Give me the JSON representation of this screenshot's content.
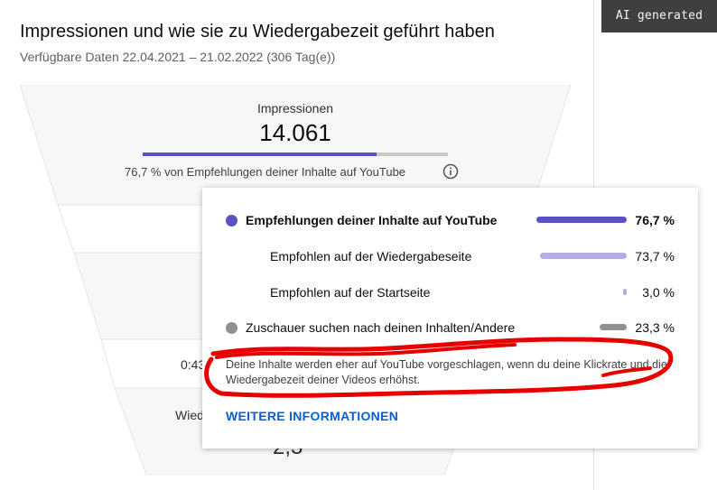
{
  "badge": "AI generated",
  "header": {
    "title": "Impressionen und wie sie zu Wiedergabezeit geführt haben",
    "subtitle": "Verfügbare Daten 22.04.2021 – 21.02.2022 (306 Tag(e))"
  },
  "funnel": {
    "impressions_label": "Impressionen",
    "impressions_value": "14.061",
    "recommendation_share": 0.767,
    "impressions_desc": "76,7 % von Empfehlungen deiner Inhalte auf YouTube",
    "stage_partial_1": "0:43",
    "stage_partial_2": "Wied",
    "stage_partial_3": "2,3"
  },
  "popup": {
    "rows": [
      {
        "label": "Empfehlungen deiner Inhalte auf YouTube",
        "value": "76,7 %",
        "fraction": 0.767,
        "color": "#5c51c4"
      },
      {
        "label": "Empfohlen auf der Wiedergabeseite",
        "value": "73,7 %",
        "fraction": 0.737,
        "color": "#b3aee6"
      },
      {
        "label": "Empfohlen auf der Startseite",
        "value": "3,0 %",
        "fraction": 0.03,
        "color": "#b3aee6"
      },
      {
        "label": "Zuschauer suchen nach deinen Inhalten/Andere",
        "value": "23,3 %",
        "fraction": 0.233,
        "color": "#909090"
      }
    ],
    "note": "Deine Inhalte werden eher auf YouTube vorgeschlagen, wenn du deine Klickrate und die Wiedergabezeit deiner Videos erhöhst.",
    "more_link": "WEITERE INFORMATIONEN"
  },
  "colors": {
    "accent": "#5c51c4",
    "link": "#065fd4",
    "annotation": "#e60000"
  }
}
